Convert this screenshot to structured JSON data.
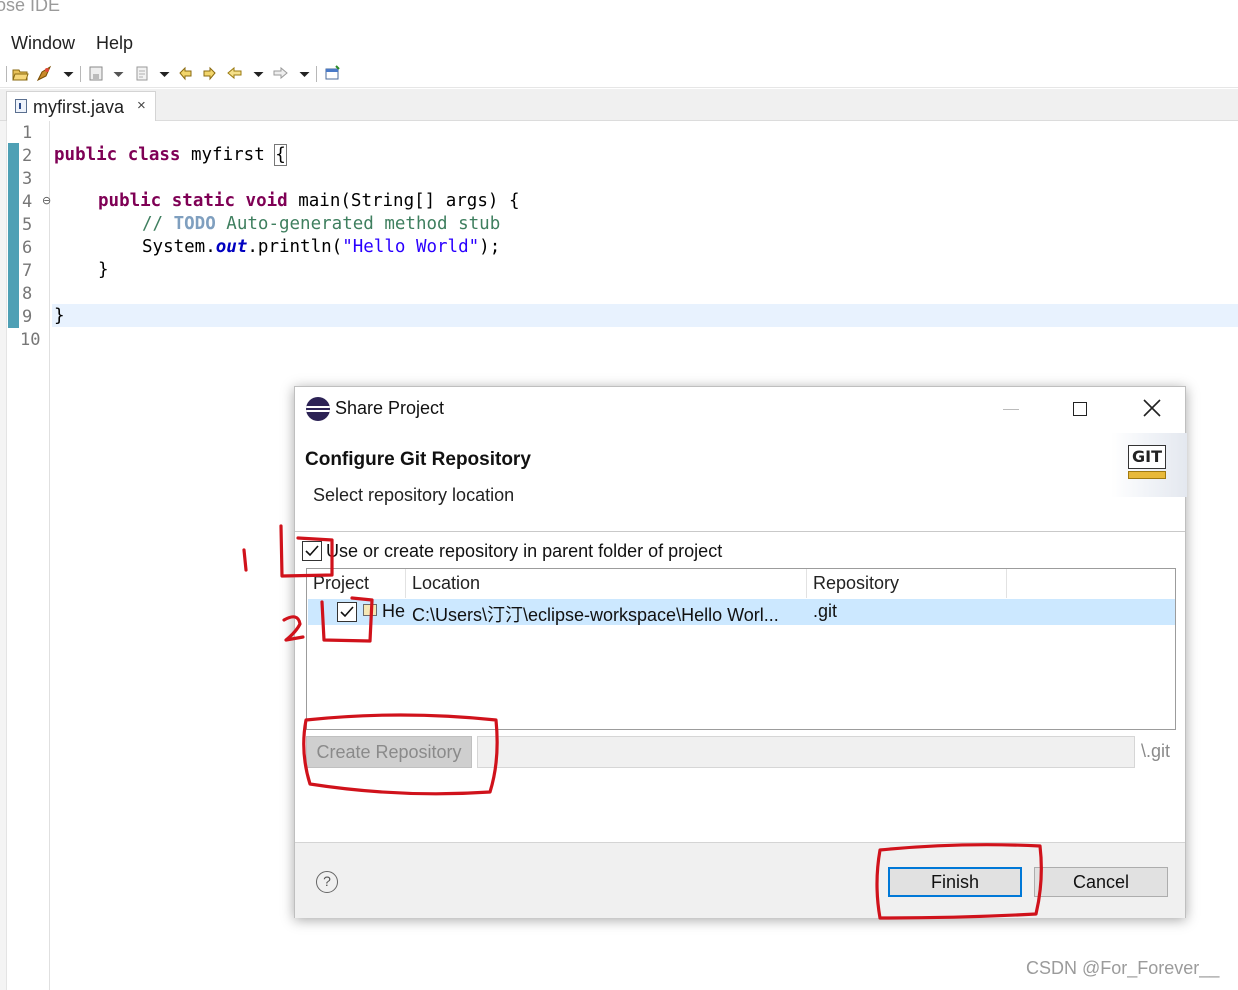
{
  "window": {
    "title_fragment": "ose IDE"
  },
  "menu": {
    "items": [
      "Window",
      "Help"
    ]
  },
  "toolbar": {
    "icons": [
      "open-folder-icon",
      "run-launch-icon",
      "dropdown-arrow-icon",
      "save-icon",
      "dropdown-arrow-icon",
      "publish-icon",
      "dropdown-arrow-icon",
      "prev-annotation-icon",
      "next-annotation-icon",
      "back-arrow-icon",
      "dropdown-arrow-icon",
      "forward-arrow-icon",
      "dropdown-arrow-icon",
      "new-window-icon"
    ]
  },
  "editor": {
    "tab": {
      "label": "myfirst.java",
      "close": "×"
    },
    "line_numbers": [
      "1",
      "2",
      "3",
      "4",
      "5",
      "6",
      "7",
      "8",
      "9",
      "10"
    ],
    "code": {
      "l2_kw1": "public",
      "l2_kw2": "class",
      "l2_name": " myfirst ",
      "l2_brace": "{",
      "l4_kw1": "public",
      "l4_kw2": "static",
      "l4_kw3": "void",
      "l4_rest": " main(String[] args) {",
      "l5_cm1": "// ",
      "l5_todo": "TODO",
      "l5_cm2": " Auto-generated method stub",
      "l6_a": "System.",
      "l6_out": "out",
      "l6_b": ".println(",
      "l6_str": "\"Hello World\"",
      "l6_c": ");",
      "l7": "}",
      "l9": "}"
    }
  },
  "dialog": {
    "title": "Share Project",
    "heading": "Configure Git Repository",
    "subheading": "Select repository location",
    "badge": "GIT",
    "use_parent_label": "Use or create repository in parent folder of project",
    "use_parent_checked": true,
    "columns": [
      "Project",
      "Location",
      "Repository"
    ],
    "row": {
      "project": "He",
      "location": "C:\\Users\\汀汀\\eclipse-workspace\\Hello Worl...",
      "repository": ".git",
      "checked": true
    },
    "create_button": "Create Repository",
    "path_suffix": "\\.git",
    "help": "?",
    "finish": "Finish",
    "cancel": "Cancel"
  },
  "annotations": {
    "mark1": "1",
    "mark2": "2"
  },
  "watermark": "CSDN @For_Forever__",
  "colors": {
    "keyword": "#7f0055",
    "comment": "#3f7f5f",
    "string": "#2a00ff",
    "selection": "#cce8ff",
    "annotation_red": "#d0121b",
    "focus_blue": "#0078d7"
  }
}
